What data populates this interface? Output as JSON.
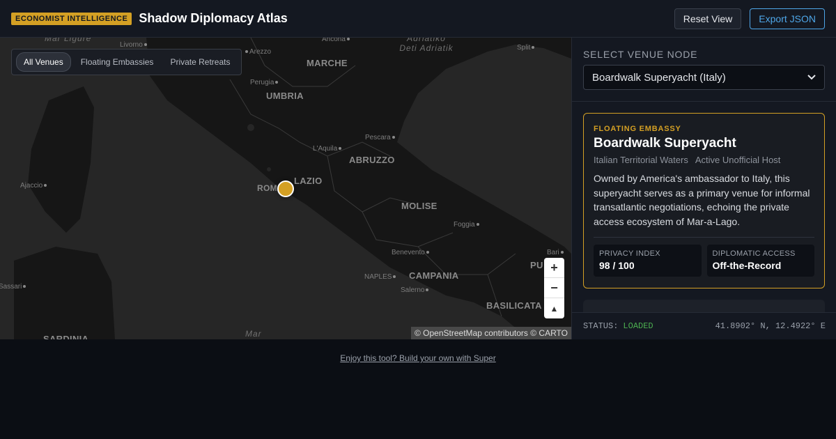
{
  "header": {
    "badge": "ECONOMIST INTELLIGENCE",
    "title": "Shadow Diplomacy Atlas",
    "reset_label": "Reset View",
    "export_label": "Export JSON"
  },
  "map": {
    "filters": [
      {
        "label": "All Venues",
        "active": true
      },
      {
        "label": "Floating Embassies",
        "active": false
      },
      {
        "label": "Private Retreats",
        "active": false
      }
    ],
    "labels": {
      "ligure": "Mar Ligure",
      "livorno": "Livorno",
      "arezzo": "Arezzo",
      "ancona": "Ancona",
      "adriatic": "Adriatiko Deti Adriatik",
      "split": "Split",
      "marche": "MARCHE",
      "perugia": "Perugia",
      "umbria": "UMBRIA",
      "pescara": "Pescara",
      "laquila": "L'Aquila",
      "abruzzo": "ABRUZZO",
      "ajaccio": "Ajaccio",
      "roma": "ROMA",
      "lazio": "LAZIO",
      "molise": "MOLISE",
      "foggia": "Foggia",
      "bari": "Bari",
      "benevento": "Benevento",
      "puglia": "PU",
      "sassari": "Sassari",
      "naples": "NAPLES",
      "campania": "CAMPANIA",
      "salerno": "Salerno",
      "basilicata": "BASILICATA",
      "sardinia": "SARDINIA",
      "mar": "Mar"
    },
    "attribution": "© OpenStreetMap contributors © CARTO",
    "zoom_in": "+",
    "zoom_out": "−",
    "compass": "▲"
  },
  "panel": {
    "select_label": "Select Venue Node",
    "selected_venue": "Boardwalk Superyacht (Italy)",
    "card": {
      "type": "FLOATING EMBASSY",
      "title": "Boardwalk Superyacht",
      "location": "Italian Territorial Waters",
      "status": "Active Unofficial Host",
      "description": "Owned by America's ambassador to Italy, this superyacht serves as a primary venue for informal transatlantic negotiations, echoing the private access ecosystem of Mar-a-Lago.",
      "stats": [
        {
          "label": "PRIVACY INDEX",
          "value": "98 / 100"
        },
        {
          "label": "DIPLOMATIC ACCESS",
          "value": "Off-the-Record"
        }
      ]
    },
    "status_label": "STATUS:",
    "status_value": "LOADED",
    "coords": "41.8902° N, 12.4922° E"
  },
  "footer": {
    "link": "Enjoy this tool? Build your own with Super"
  },
  "colors": {
    "accent": "#d4a024",
    "link": "#4ea6e8",
    "status_ok": "#4caf50"
  }
}
